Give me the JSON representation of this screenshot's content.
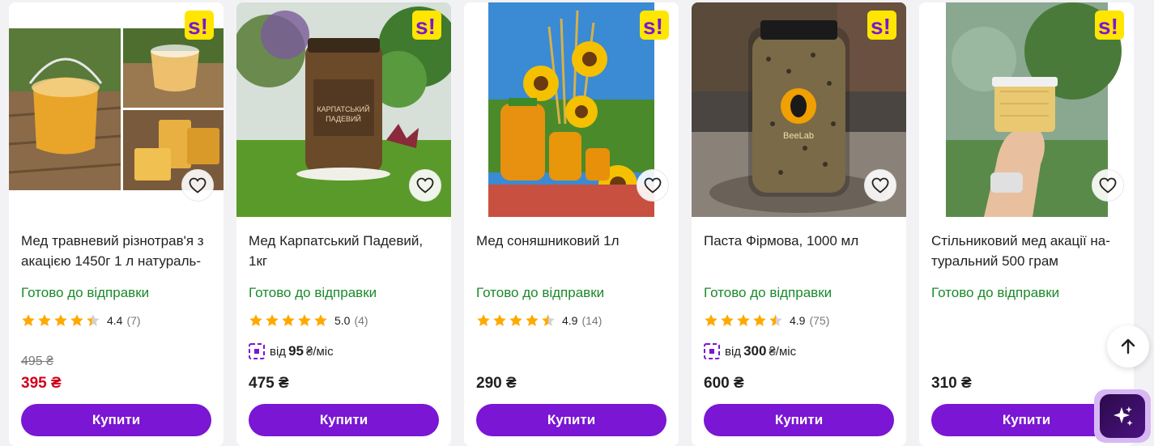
{
  "buy_label": "Купити",
  "colors": {
    "accent": "#7a16d4",
    "status": "#1a8a2a",
    "sale_price": "#d0021b",
    "star": "#ffa900"
  },
  "products": [
    {
      "title": "Мед травневий різнотрав'я з акацією 1450г 1 л натураль-",
      "status": "Готово до відправки",
      "rating": "4.4",
      "rating_count": "(7)",
      "rating_stars": 4.4,
      "old_price": "495 ₴",
      "price": "395 ₴",
      "icons": [
        "super-deal-badge-icon",
        "heart-icon",
        "star-icon"
      ]
    },
    {
      "title": "Мед Карпатський Падевий, 1кг",
      "status": "Готово до відправки",
      "rating": "5.0",
      "rating_count": "(4)",
      "rating_stars": 5.0,
      "installment_prefix": "від",
      "installment_amount": "95",
      "installment_suffix": "₴/міс",
      "price": "475 ₴",
      "image_label_line1": "КАРПАТСЬКИЙ",
      "image_label_line2": "ПАДЕВИЙ"
    },
    {
      "title": "Мед соняшниковий 1л",
      "status": "Готово до відправки",
      "rating": "4.9",
      "rating_count": "(14)",
      "rating_stars": 4.5,
      "price": "290 ₴"
    },
    {
      "title": "Паста Фірмова, 1000 мл",
      "status": "Готово до відправки",
      "rating": "4.9",
      "rating_count": "(75)",
      "rating_stars": 4.5,
      "installment_prefix": "від",
      "installment_amount": "300",
      "installment_suffix": "₴/міс",
      "price": "600 ₴",
      "image_label": "BeeLab"
    },
    {
      "title": "Стільниковий мед акації на-турaльний 500 грам",
      "status": "Готово до відправки",
      "price": "310 ₴"
    }
  ]
}
